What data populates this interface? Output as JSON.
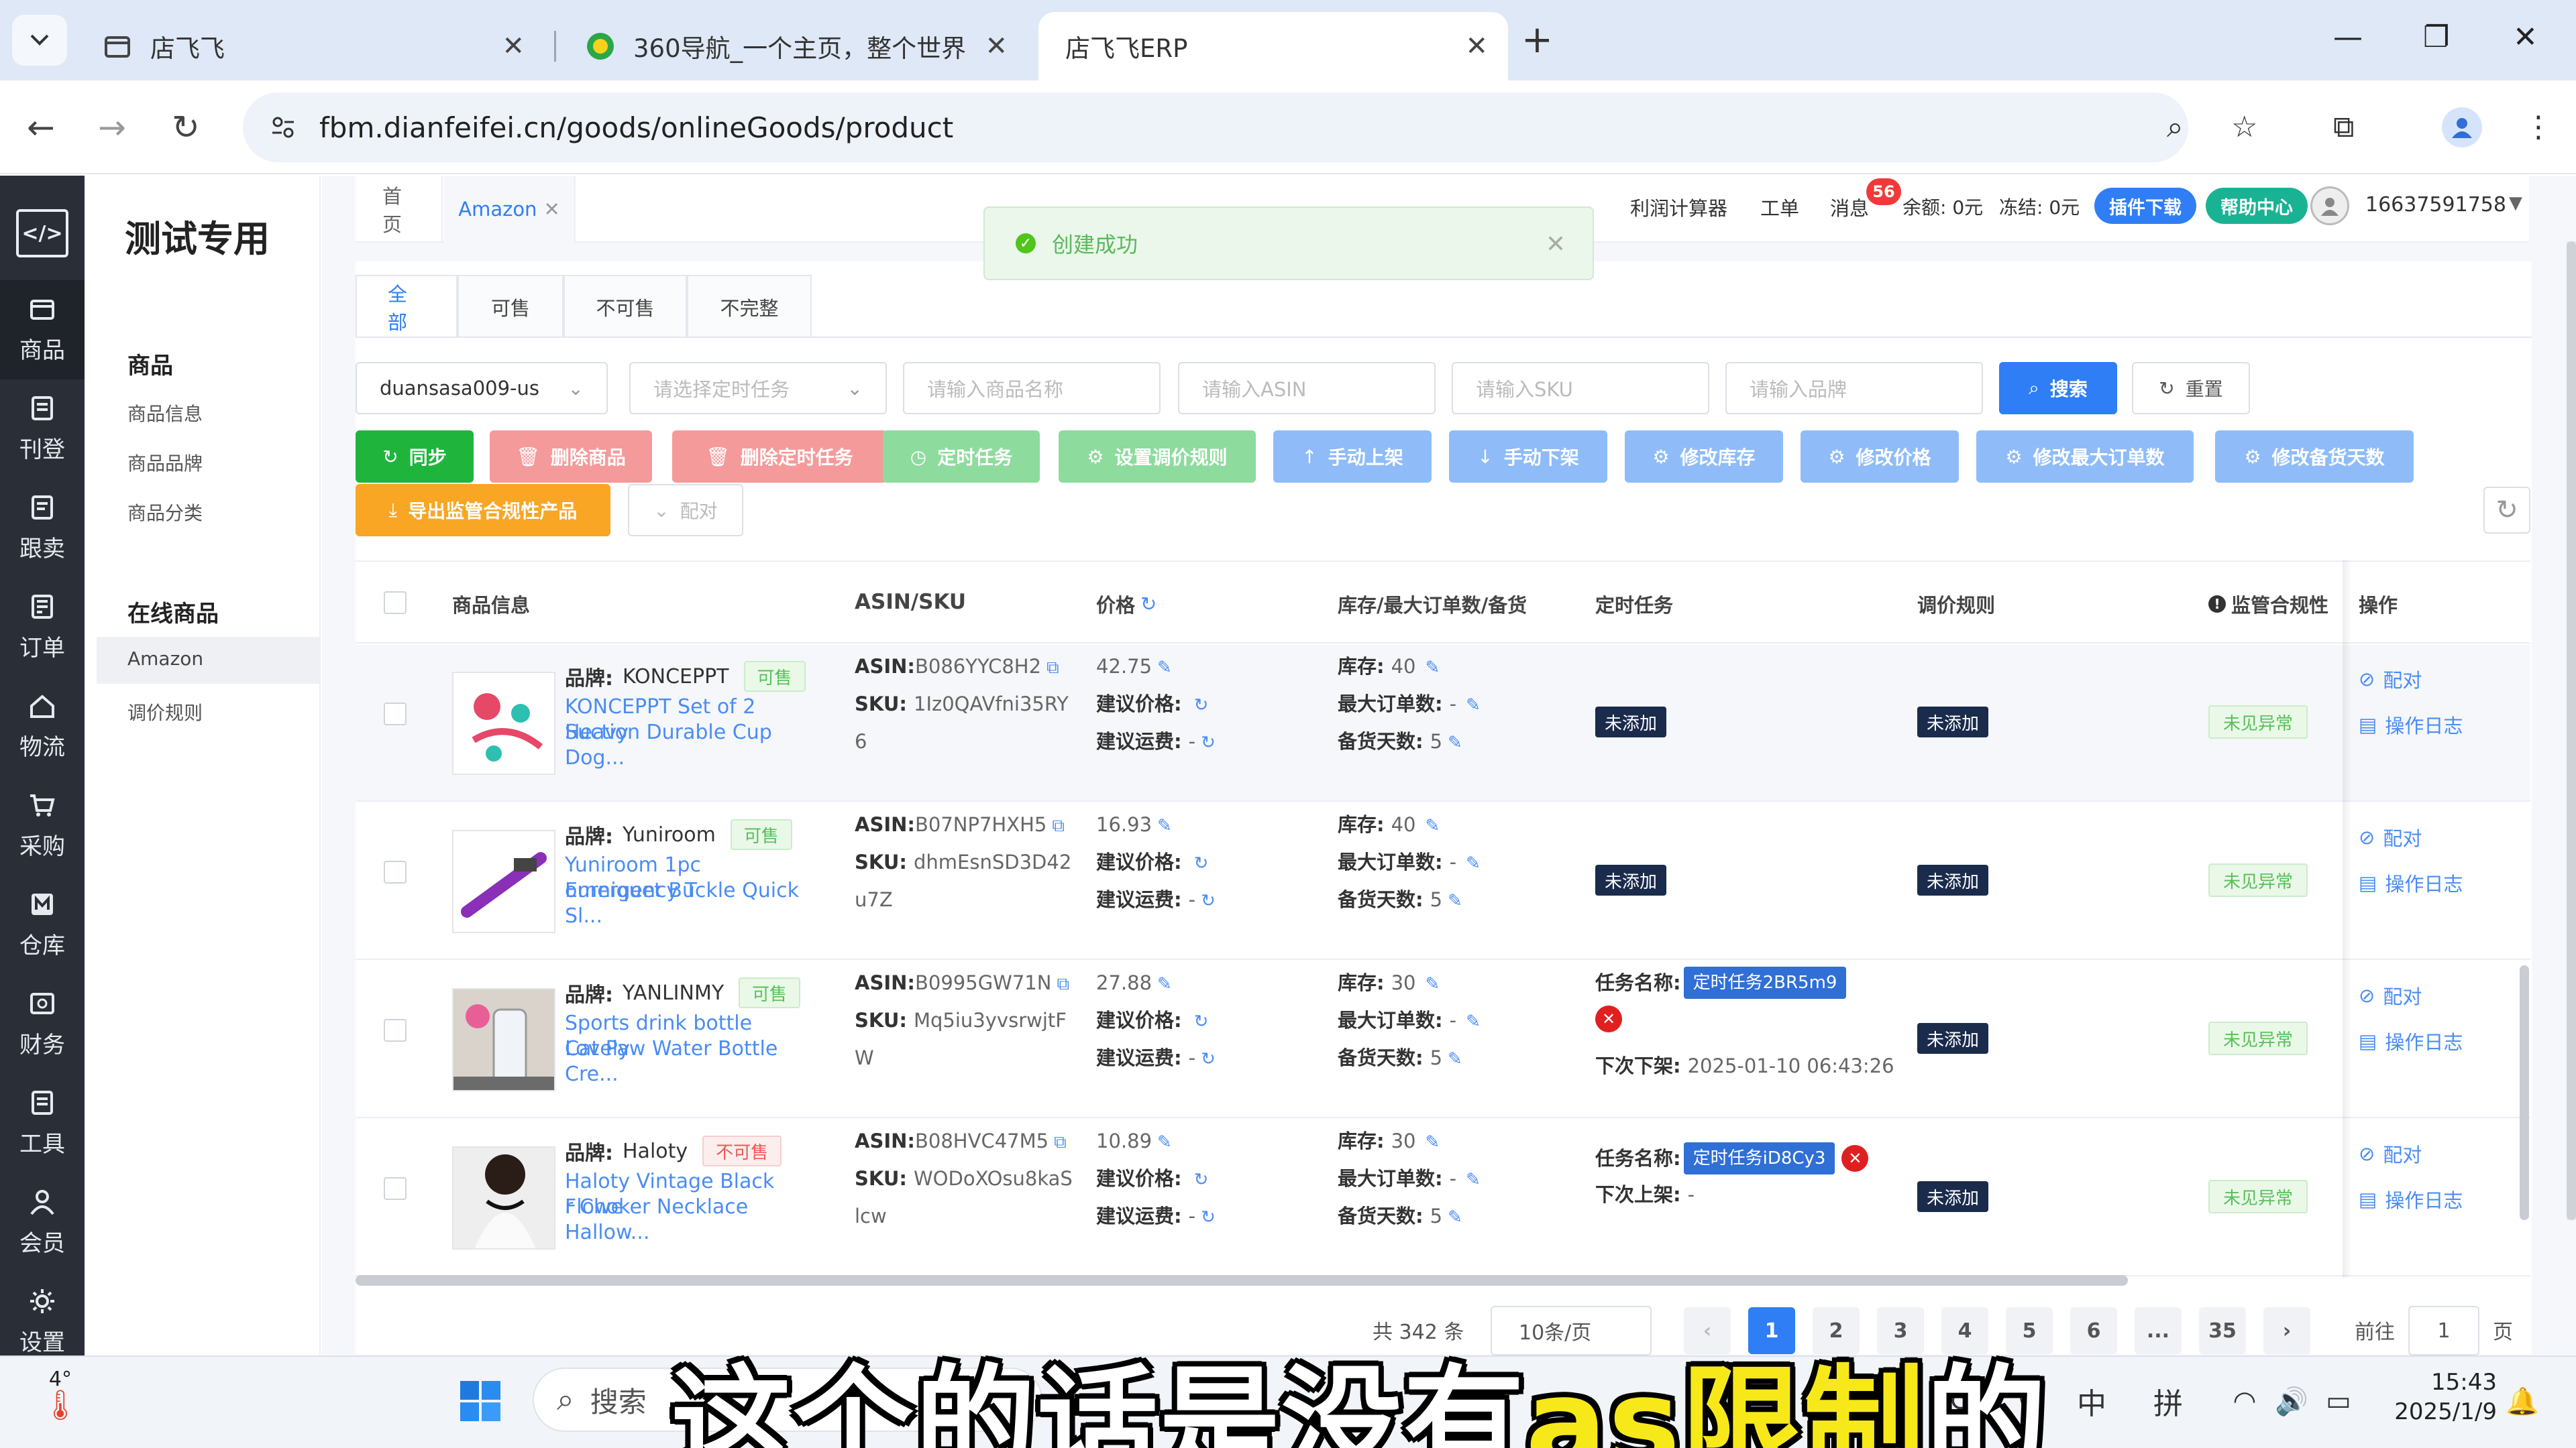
{
  "browser": {
    "tabs": [
      {
        "title": "店飞飞"
      },
      {
        "title": "360导航_一个主页，整个世界"
      },
      {
        "title": "店飞飞ERP"
      }
    ],
    "url": "fbm.dianfeifei.cn/goods/onlineGoods/product"
  },
  "sidebar": {
    "logo": "</>",
    "items": [
      {
        "label": "商品",
        "icon": "box-icon"
      },
      {
        "label": "刊登",
        "icon": "publish-icon"
      },
      {
        "label": "跟卖",
        "icon": "follow-sell-icon"
      },
      {
        "label": "订单",
        "icon": "order-icon"
      },
      {
        "label": "物流",
        "icon": "logistics-icon"
      },
      {
        "label": "采购",
        "icon": "cart-icon"
      },
      {
        "label": "仓库",
        "icon": "warehouse-icon"
      },
      {
        "label": "财务",
        "icon": "finance-icon"
      },
      {
        "label": "工具",
        "icon": "tool-icon"
      },
      {
        "label": "会员",
        "icon": "member-icon"
      },
      {
        "label": "设置",
        "icon": "settings-icon"
      }
    ]
  },
  "subnav": {
    "title": "测试专用",
    "group1": {
      "heading": "商品",
      "items": [
        "商品信息",
        "商品品牌",
        "商品分类"
      ]
    },
    "group2": {
      "heading": "在线商品",
      "items": [
        "Amazon",
        "调价规则"
      ]
    }
  },
  "topnav": {
    "page_tabs": [
      "首页",
      "Amazon"
    ],
    "links": [
      "利润计算器",
      "工单",
      "消息"
    ],
    "message_badge": "56",
    "balance": "余额: 0元",
    "frozen": "冻结: 0元",
    "plugin_btn": "插件下载",
    "help_btn": "帮助中心",
    "phone": "16637591758"
  },
  "toast": {
    "message": "创建成功"
  },
  "filter_tabs": [
    "全部",
    "可售",
    "不可售",
    "不完整"
  ],
  "filters": {
    "store": "duansasa009-us",
    "task_ph": "请选择定时任务",
    "name_ph": "请输入商品名称",
    "asin_ph": "请输入ASIN",
    "sku_ph": "请输入SKU",
    "brand_ph": "请输入品牌",
    "search": "搜索",
    "reset": "重置"
  },
  "actions": [
    {
      "label": "同步",
      "color": "#1fb53c"
    },
    {
      "label": "删除商品",
      "color": "#f59a9a"
    },
    {
      "label": "删除定时任务",
      "color": "#f59a9a"
    },
    {
      "label": "定时任务",
      "color": "#8edb9e"
    },
    {
      "label": "设置调价规则",
      "color": "#8edb9e"
    },
    {
      "label": "手动上架",
      "color": "#8fbcf8"
    },
    {
      "label": "手动下架",
      "color": "#8fbcf8"
    },
    {
      "label": "修改库存",
      "color": "#8fbcf8"
    },
    {
      "label": "修改价格",
      "color": "#8fbcf8"
    },
    {
      "label": "修改最大订单数",
      "color": "#8fbcf8"
    },
    {
      "label": "修改备货天数",
      "color": "#8fbcf8"
    },
    {
      "label": "导出监管合规性产品",
      "color": "#f8a623"
    },
    {
      "label": "配对",
      "color": "#ffffff"
    }
  ],
  "table": {
    "headers": [
      "商品信息",
      "ASIN/SKU",
      "价格",
      "库存/最大订单数/备货",
      "定时任务",
      "调价规则",
      "监管合规性",
      "操作"
    ],
    "labels": {
      "brand": "品牌:",
      "asin": "ASIN:",
      "sku": "SKU:",
      "suggest_price": "建议价格:",
      "suggest_ship": "建议运费:",
      "stock": "库存:",
      "max_order": "最大订单数:",
      "days": "备货天数:",
      "task_name": "任务名称:",
      "next_off": "下次下架:",
      "next_on": "下次上架:",
      "not_added": "未添加",
      "compliance": "未见异常",
      "pair": "配对",
      "log": "操作日志",
      "dash": "-"
    },
    "rows": [
      {
        "brand": "KONCEPPT",
        "status": "可售",
        "status_type": "ok",
        "title1": "KONCEPPT Set of 2 Heavy",
        "title2": "Suction Durable Cup Dog...",
        "asin": "B086YYC8H2",
        "sku1": "1Iz0QAVfni35RY",
        "sku2": "6",
        "price": "42.75",
        "stock": "40",
        "days": "5",
        "task": null
      },
      {
        "brand": "Yuniroom",
        "status": "可售",
        "status_type": "ok",
        "title1": "Yuniroom 1pc Emergency T",
        "title2": "ourniquet Buckle Quick Sl...",
        "asin": "B07NP7HXH5",
        "sku1": "dhmEsnSD3D42",
        "sku2": "u7Z",
        "price": "16.93",
        "stock": "40",
        "days": "5",
        "task": null
      },
      {
        "brand": "YANLINMY",
        "status": "可售",
        "status_type": "ok",
        "title1": "Sports drink bottle Lovely",
        "title2": "Cat Paw Water Bottle Cre...",
        "asin": "B0995GW71N",
        "sku1": "Mq5iu3yvsrwjtF",
        "sku2": "W",
        "price": "27.88",
        "stock": "30",
        "days": "5",
        "task": {
          "name": "定时任务2BR5m9",
          "next_label": "下次下架:",
          "next_value": "2025-01-10 06:43:26"
        }
      },
      {
        "brand": "Haloty",
        "status": "不可售",
        "status_type": "no",
        "title1": "Haloty Vintage Black Flowe",
        "title2": "r Choker Necklace Hallow...",
        "asin": "B08HVC47M5",
        "sku1": "WODoXOsu8kaS",
        "sku2": "lcw",
        "price": "10.89",
        "stock": "30",
        "days": "5",
        "task": {
          "name": "定时任务iD8Cy3",
          "next_label": "下次上架:",
          "next_value": "-"
        }
      }
    ]
  },
  "pagination": {
    "total": "共 342 条",
    "page_size": "10条/页",
    "pages": [
      "1",
      "2",
      "3",
      "4",
      "5",
      "6",
      "...",
      "35"
    ],
    "goto_prefix": "前往",
    "goto_value": "1",
    "goto_suffix": "页"
  },
  "taskbar": {
    "weather": "4°",
    "search": "搜索",
    "ime1": "中",
    "ime2": "拼",
    "time": "15:43",
    "date": "2025/1/9"
  },
  "subtitle": {
    "part1": "这个的话是没有",
    "highlight": "as限制",
    "part2": "的"
  }
}
